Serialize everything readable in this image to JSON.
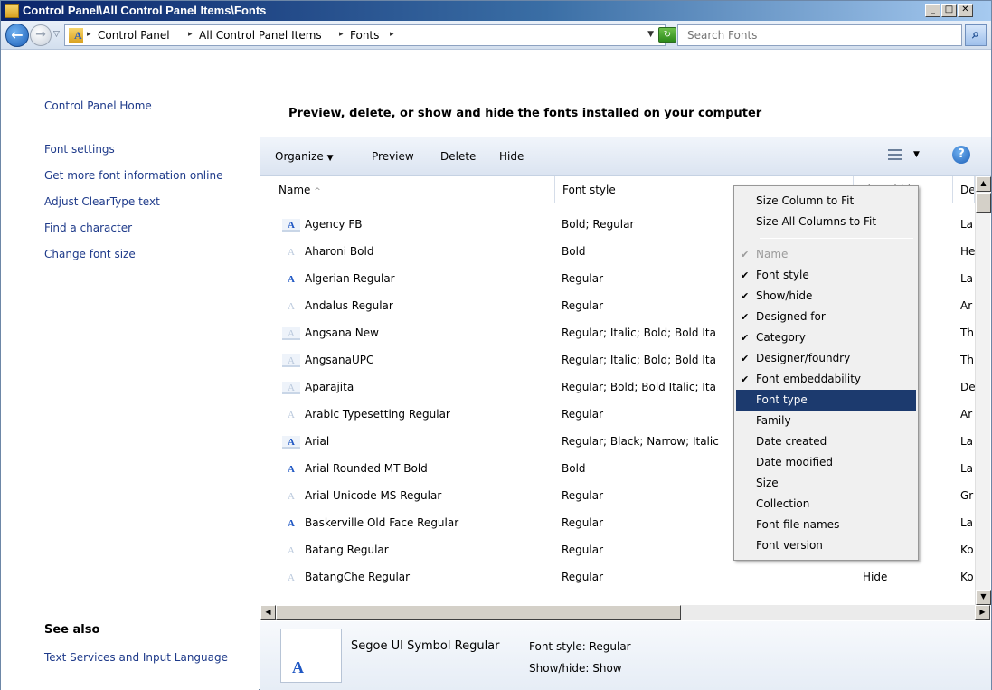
{
  "window": {
    "title": "Control Panel\\All Control Panel Items\\Fonts"
  },
  "address": {
    "crumbs": [
      "Control Panel",
      "All Control Panel Items",
      "Fonts"
    ],
    "search_placeholder": "Search Fonts"
  },
  "nav": {
    "home": "Control Panel Home",
    "links": [
      "Font settings",
      "Get more font information online",
      "Adjust ClearType text",
      "Find a character",
      "Change font size"
    ],
    "see_also_title": "See also",
    "see_also_link": "Text Services and Input Language"
  },
  "heading": "Preview, delete, or show and hide the fonts installed on your computer",
  "toolbar": {
    "organize": "Organize",
    "preview": "Preview",
    "delete": "Delete",
    "hide": "Hide"
  },
  "columns": [
    "Name",
    "Font style",
    "Show/hide",
    "De"
  ],
  "fonts": [
    {
      "name": "Agency FB",
      "style": "Bold; Regular",
      "show": "",
      "designed": "La"
    },
    {
      "name": "Aharoni Bold",
      "style": "Bold",
      "show": "",
      "designed": "He"
    },
    {
      "name": "Algerian Regular",
      "style": "Regular",
      "show": "",
      "designed": "La"
    },
    {
      "name": "Andalus Regular",
      "style": "Regular",
      "show": "",
      "designed": "Ar"
    },
    {
      "name": "Angsana New",
      "style": "Regular; Italic; Bold; Bold Ita",
      "show": "",
      "designed": "Th"
    },
    {
      "name": "AngsanaUPC",
      "style": "Regular; Italic; Bold; Bold Ita",
      "show": "",
      "designed": "Th"
    },
    {
      "name": "Aparajita",
      "style": "Regular; Bold; Bold Italic; Ita",
      "show": "",
      "designed": "De"
    },
    {
      "name": "Arabic Typesetting Regular",
      "style": "Regular",
      "show": "",
      "designed": "Ar"
    },
    {
      "name": "Arial",
      "style": "Regular; Black; Narrow; Italic",
      "show": "",
      "designed": "La"
    },
    {
      "name": "Arial Rounded MT Bold",
      "style": "Bold",
      "show": "",
      "designed": "La"
    },
    {
      "name": "Arial Unicode MS Regular",
      "style": "Regular",
      "show": "",
      "designed": "Gr"
    },
    {
      "name": "Baskerville Old Face Regular",
      "style": "Regular",
      "show": "",
      "designed": "La"
    },
    {
      "name": "Batang Regular",
      "style": "Regular",
      "show": "",
      "designed": "Ko"
    },
    {
      "name": "BatangChe Regular",
      "style": "Regular",
      "show": "Hide",
      "designed": "Ko"
    }
  ],
  "menu": {
    "items": [
      {
        "label": "Size Column to Fit",
        "checked": false,
        "disabled": false
      },
      {
        "label": "Size All Columns to Fit",
        "checked": false,
        "disabled": false
      },
      {
        "label": "Name",
        "checked": true,
        "disabled": true
      },
      {
        "label": "Font style",
        "checked": true,
        "disabled": false
      },
      {
        "label": "Show/hide",
        "checked": true,
        "disabled": false
      },
      {
        "label": "Designed for",
        "checked": true,
        "disabled": false
      },
      {
        "label": "Category",
        "checked": true,
        "disabled": false
      },
      {
        "label": "Designer/foundry",
        "checked": true,
        "disabled": false
      },
      {
        "label": "Font embeddability",
        "checked": true,
        "disabled": false
      },
      {
        "label": "Font type",
        "checked": false,
        "disabled": false,
        "selected": true
      },
      {
        "label": "Family",
        "checked": false,
        "disabled": false
      },
      {
        "label": "Date created",
        "checked": false,
        "disabled": false
      },
      {
        "label": "Date modified",
        "checked": false,
        "disabled": false
      },
      {
        "label": "Size",
        "checked": false,
        "disabled": false
      },
      {
        "label": "Collection",
        "checked": false,
        "disabled": false
      },
      {
        "label": "Font file names",
        "checked": false,
        "disabled": false
      },
      {
        "label": "Font version",
        "checked": false,
        "disabled": false
      }
    ]
  },
  "details": {
    "name": "Segoe UI Symbol Regular",
    "font_style_label": "Font style: Regular",
    "show_hide_label": "Show/hide: Show"
  },
  "colors": {
    "accent": "#1c3a6e",
    "link": "#1e3a8a"
  }
}
